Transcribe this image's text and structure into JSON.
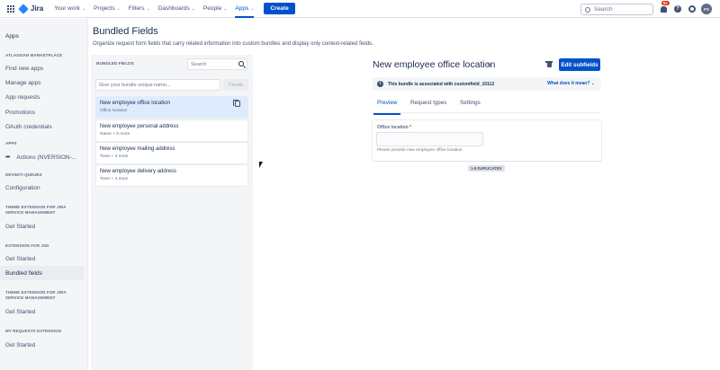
{
  "nav": {
    "logo": "Jira",
    "items": [
      {
        "label": "Your work",
        "has_chevron": true
      },
      {
        "label": "Projects",
        "has_chevron": true
      },
      {
        "label": "Filters",
        "has_chevron": true
      },
      {
        "label": "Dashboards",
        "has_chevron": true
      },
      {
        "label": "People",
        "has_chevron": true
      },
      {
        "label": "Apps",
        "has_chevron": true
      }
    ],
    "active_item": "Apps",
    "create_label": "Create",
    "search_placeholder": "Search",
    "notification_badge": "9+",
    "help_glyph": "?",
    "avatar_initials": "FS",
    "chevron_glyph": "⌄",
    "icons": [
      "app-switcher-icon",
      "jira-logo-icon",
      "search-icon",
      "notifications-icon",
      "help-icon",
      "settings-icon"
    ]
  },
  "sidebar": {
    "title": "Apps",
    "sections": [
      {
        "heading": "ATLASSIAN MARKETPLACE",
        "items": [
          "Find new apps",
          "Manage apps",
          "App requests",
          "Promotions",
          "OAuth credentials"
        ]
      },
      {
        "heading": "APPS",
        "items": [
          "Actions (NVERSION-..."
        ]
      },
      {
        "heading": "DEVINITI QUEUES",
        "items": [
          "Configuration"
        ]
      },
      {
        "heading": "THEME EXTENSION FOR JIRA SERVICE MANAGEMENT",
        "items": [
          "Get Started"
        ]
      },
      {
        "heading": "EXTENSION FOR JSD",
        "items": [
          "Get Started",
          "Bundled fields"
        ]
      },
      {
        "heading": "THEME EXTENSION FOR JIRA SERVICE MANAGEMENT",
        "items": [
          "Get Started"
        ]
      },
      {
        "heading": "MY REQUESTS EXTENSION",
        "items": [
          "Get Started"
        ]
      }
    ],
    "selected_item": "Bundled fields"
  },
  "page": {
    "title": "Bundled Fields",
    "description": "Organize request form fields that carry related information into custom bundles and display only context-related fields."
  },
  "list": {
    "label": "BUNDLED FIELDS",
    "search_placeholder": "Search",
    "name_placeholder": "Give your bundle unique name...",
    "create_label": "Create",
    "bundles": [
      {
        "title": "New employee office location",
        "subtitle": "Office location",
        "selected": true
      },
      {
        "title": "New employee personal address",
        "subtitle": "Name + 6 more",
        "selected": false
      },
      {
        "title": "New employee mailing address",
        "subtitle": "Town + 3 more",
        "selected": false
      },
      {
        "title": "New employee delivery address",
        "subtitle": "Town + 4 more",
        "selected": false
      }
    ]
  },
  "detail": {
    "title": "New employee office location",
    "edit_label": "Edit subfields",
    "banner_text": "This bundle is associated with customfield_10112",
    "banner_link": "What does it mean?",
    "tabs": [
      "Preview",
      "Request types",
      "Settings"
    ],
    "active_tab": "Preview",
    "field_label": "Office location",
    "field_required_mark": "*",
    "field_help": "Please provide new employee office location",
    "duplicates_badge": "1-5 DUPLICATES"
  },
  "colors": {
    "brand": "#0052cc",
    "selected_card": "#deebff",
    "panel_bg": "#f4f5f7",
    "badge_red": "#de350b"
  }
}
